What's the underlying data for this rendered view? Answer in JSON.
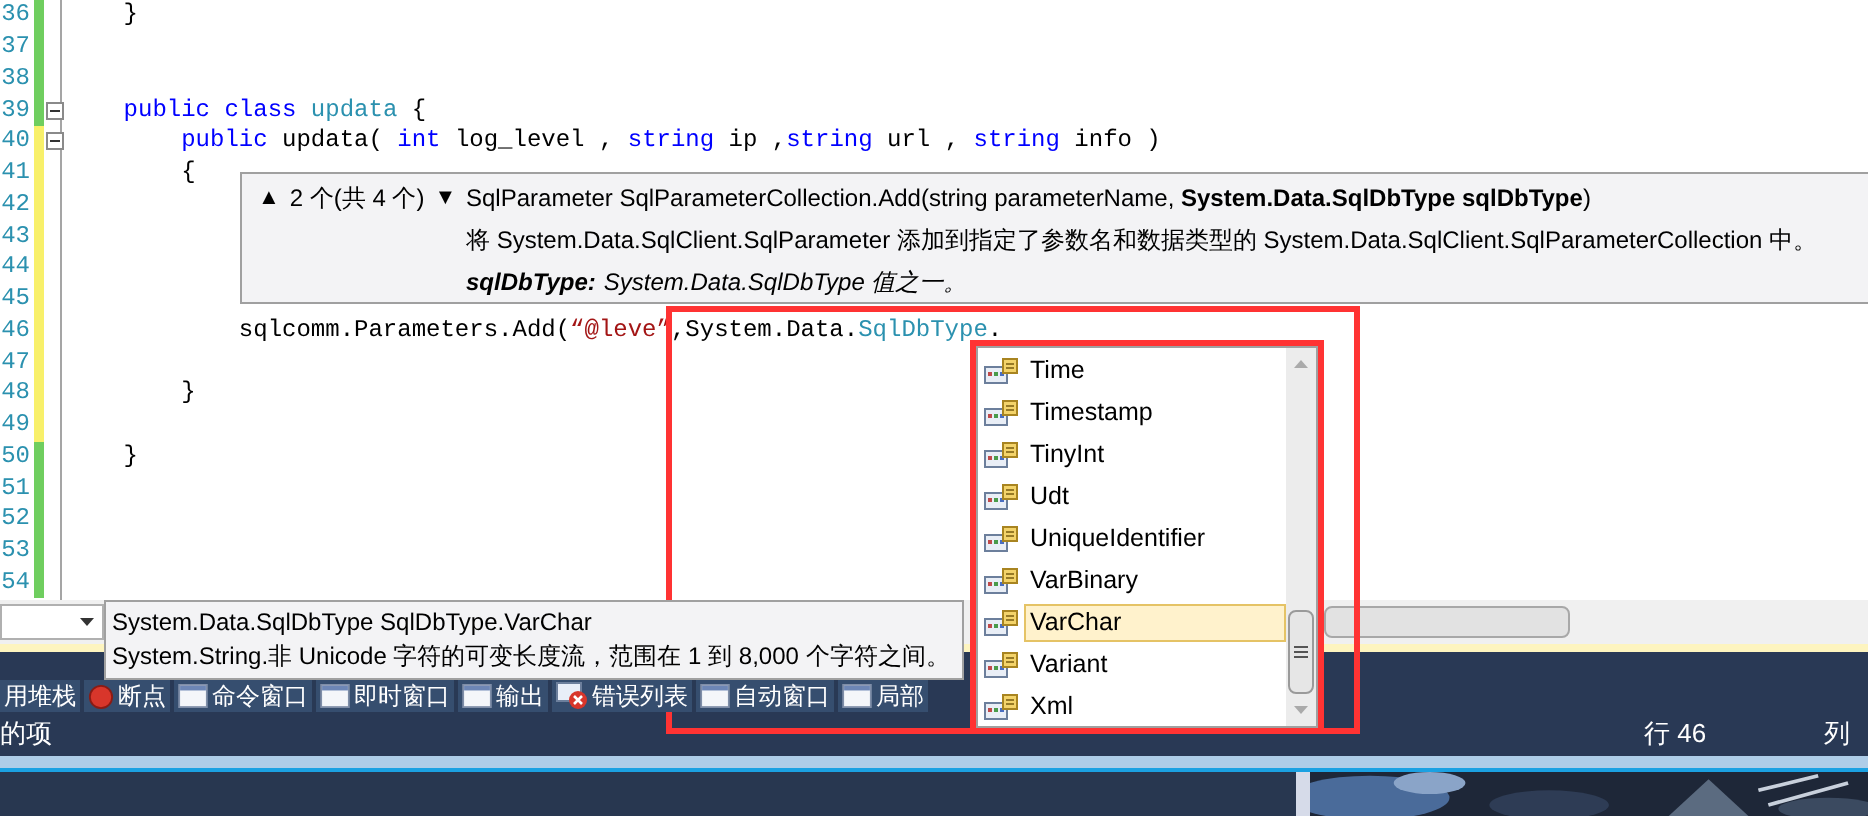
{
  "editor": {
    "lines": [
      {
        "number": "36",
        "modified": false,
        "fold": false,
        "tokens": [
          {
            "text": "    }",
            "kind": "plain"
          }
        ]
      },
      {
        "number": "37",
        "modified": false,
        "fold": false
      },
      {
        "number": "38",
        "modified": false,
        "fold": false
      },
      {
        "number": "39",
        "modified": false,
        "fold": true,
        "tokens": [
          {
            "text": "    public",
            "kind": "keyword"
          },
          {
            "text": " class",
            "kind": "keyword"
          },
          {
            "text": " updata",
            "kind": "type"
          },
          {
            "text": " {",
            "kind": "plain"
          }
        ]
      },
      {
        "number": "40",
        "modified": true,
        "fold": true,
        "tokens": [
          {
            "text": "        public",
            "kind": "keyword"
          },
          {
            "text": " updata( ",
            "kind": "plain"
          },
          {
            "text": "int",
            "kind": "keyword"
          },
          {
            "text": " log_level , ",
            "kind": "plain"
          },
          {
            "text": "string",
            "kind": "keyword"
          },
          {
            "text": " ip ,",
            "kind": "plain"
          },
          {
            "text": "string",
            "kind": "keyword"
          },
          {
            "text": " url , ",
            "kind": "plain"
          },
          {
            "text": "string",
            "kind": "keyword"
          },
          {
            "text": " info )",
            "kind": "plain"
          }
        ]
      },
      {
        "number": "41",
        "modified": true,
        "fold": false,
        "tokens": [
          {
            "text": "        {",
            "kind": "plain"
          }
        ]
      },
      {
        "number": "42",
        "modified": true,
        "fold": false
      },
      {
        "number": "43",
        "modified": true,
        "fold": false
      },
      {
        "number": "44",
        "modified": true,
        "fold": false
      },
      {
        "number": "45",
        "modified": true,
        "fold": false
      },
      {
        "number": "46",
        "modified": true,
        "fold": false,
        "tokens": [
          {
            "text": "            sqlcomm.Parameters.Add(",
            "kind": "plain"
          },
          {
            "text": "“@leve”",
            "kind": "string"
          },
          {
            "text": ",System.Data.",
            "kind": "plain"
          },
          {
            "text": "SqlDbType",
            "kind": "type"
          },
          {
            "text": ".",
            "kind": "plain"
          }
        ]
      },
      {
        "number": "47",
        "modified": true,
        "fold": false
      },
      {
        "number": "48",
        "modified": true,
        "fold": false,
        "tokens": [
          {
            "text": "        }",
            "kind": "plain"
          }
        ]
      },
      {
        "number": "49",
        "modified": true,
        "fold": false
      },
      {
        "number": "50",
        "modified": false,
        "fold": false,
        "tokens": [
          {
            "text": "    }",
            "kind": "plain"
          }
        ]
      },
      {
        "number": "51",
        "modified": false,
        "fold": false
      },
      {
        "number": "52",
        "modified": false,
        "fold": false
      },
      {
        "number": "53",
        "modified": false,
        "fold": false
      },
      {
        "number": "54",
        "modified": false,
        "fold": false
      }
    ]
  },
  "parameter_info": {
    "up": "▲",
    "counter": "2 个(共 4 个)",
    "down": "▼",
    "signature": "SqlParameter SqlParameterCollection.Add(string parameterName, **System.Data.SqlDbType sqlDbType**)",
    "description": "将 System.Data.SqlClient.SqlParameter 添加到指定了参数名和数据类型的 System.Data.SqlClient.SqlParameterCollection 中。",
    "param_name": "sqlDbType:",
    "param_description": "System.Data.SqlDbType 值之一。"
  },
  "completion_list": {
    "items": [
      {
        "label": "Time",
        "selected": false
      },
      {
        "label": "Timestamp",
        "selected": false
      },
      {
        "label": "TinyInt",
        "selected": false
      },
      {
        "label": "Udt",
        "selected": false
      },
      {
        "label": "UniqueIdentifier",
        "selected": false
      },
      {
        "label": "VarBinary",
        "selected": false
      },
      {
        "label": "VarChar",
        "selected": true
      },
      {
        "label": "Variant",
        "selected": false
      },
      {
        "label": "Xml",
        "selected": false
      }
    ]
  },
  "quick_info": {
    "title": "System.Data.SqlDbType SqlDbType.VarChar",
    "description": "System.String.非 Unicode 字符的可变长度流，范围在 1 到 8,000 个字符之间。"
  },
  "tool_tabs": [
    {
      "label": "用堆栈"
    },
    {
      "label": "断点"
    },
    {
      "label": "命令窗口"
    },
    {
      "label": "即时窗口"
    },
    {
      "label": "输出"
    },
    {
      "label": "错误列表"
    },
    {
      "label": "自动窗口"
    },
    {
      "label": "局部"
    }
  ],
  "status_bar": {
    "message": "的项",
    "line": "行 46",
    "column": "列"
  }
}
